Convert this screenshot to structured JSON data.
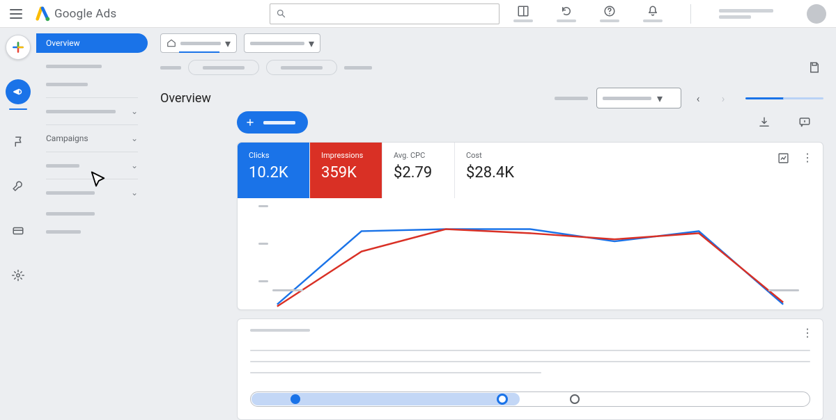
{
  "app": {
    "name": "Google Ads"
  },
  "sidenav": {
    "active": "Overview",
    "campaigns_label": "Campaigns"
  },
  "page": {
    "title": "Overview"
  },
  "metrics": [
    {
      "label": "Clicks",
      "value": "10.2K",
      "color": "blue"
    },
    {
      "label": "Impressions",
      "value": "359K",
      "color": "red"
    },
    {
      "label": "Avg. CPC",
      "value": "$2.79",
      "color": "plain"
    },
    {
      "label": "Cost",
      "value": "$28.4K",
      "color": "plain"
    }
  ],
  "chart_data": {
    "type": "line",
    "x": [
      0,
      1,
      2,
      3,
      4,
      5,
      6
    ],
    "series": [
      {
        "name": "Clicks",
        "color": "#1a73e8",
        "values": [
          8,
          80,
          82,
          82,
          70,
          80,
          8
        ]
      },
      {
        "name": "Impressions",
        "color": "#d93025",
        "values": [
          6,
          60,
          82,
          78,
          72,
          78,
          10
        ]
      }
    ],
    "ylim": [
      0,
      100
    ]
  },
  "progress": {
    "percent": 48,
    "steps": 3,
    "current": 1
  }
}
